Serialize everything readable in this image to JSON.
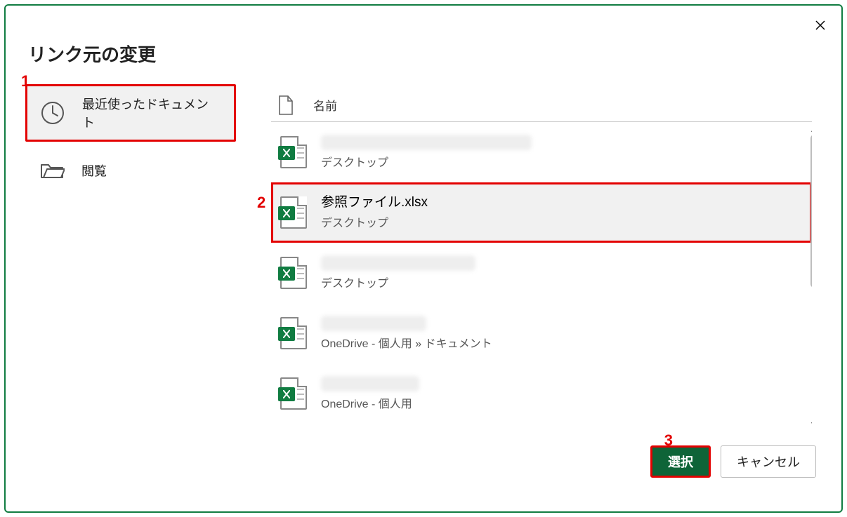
{
  "dialog": {
    "title": "リンク元の変更"
  },
  "sidebar": {
    "recent_label": "最近使ったドキュメント",
    "browse_label": "閲覧"
  },
  "header": {
    "name_col": "名前"
  },
  "files": [
    {
      "name": "",
      "location": "デスクトップ",
      "blurred": true,
      "blur_class": "w1",
      "selected": false
    },
    {
      "name": "参照ファイル.xlsx",
      "location": "デスクトップ",
      "blurred": false,
      "blur_class": "",
      "selected": true
    },
    {
      "name": "",
      "location": "デスクトップ",
      "blurred": true,
      "blur_class": "w2",
      "selected": false
    },
    {
      "name": "",
      "location": "OneDrive - 個人用 » ドキュメント",
      "blurred": true,
      "blur_class": "w3",
      "selected": false
    },
    {
      "name": "",
      "location": "OneDrive - 個人用",
      "blurred": true,
      "blur_class": "w4",
      "selected": false
    }
  ],
  "buttons": {
    "select": "選択",
    "cancel": "キャンセル"
  },
  "callouts": {
    "c1": "1",
    "c2": "2",
    "c3": "3"
  }
}
